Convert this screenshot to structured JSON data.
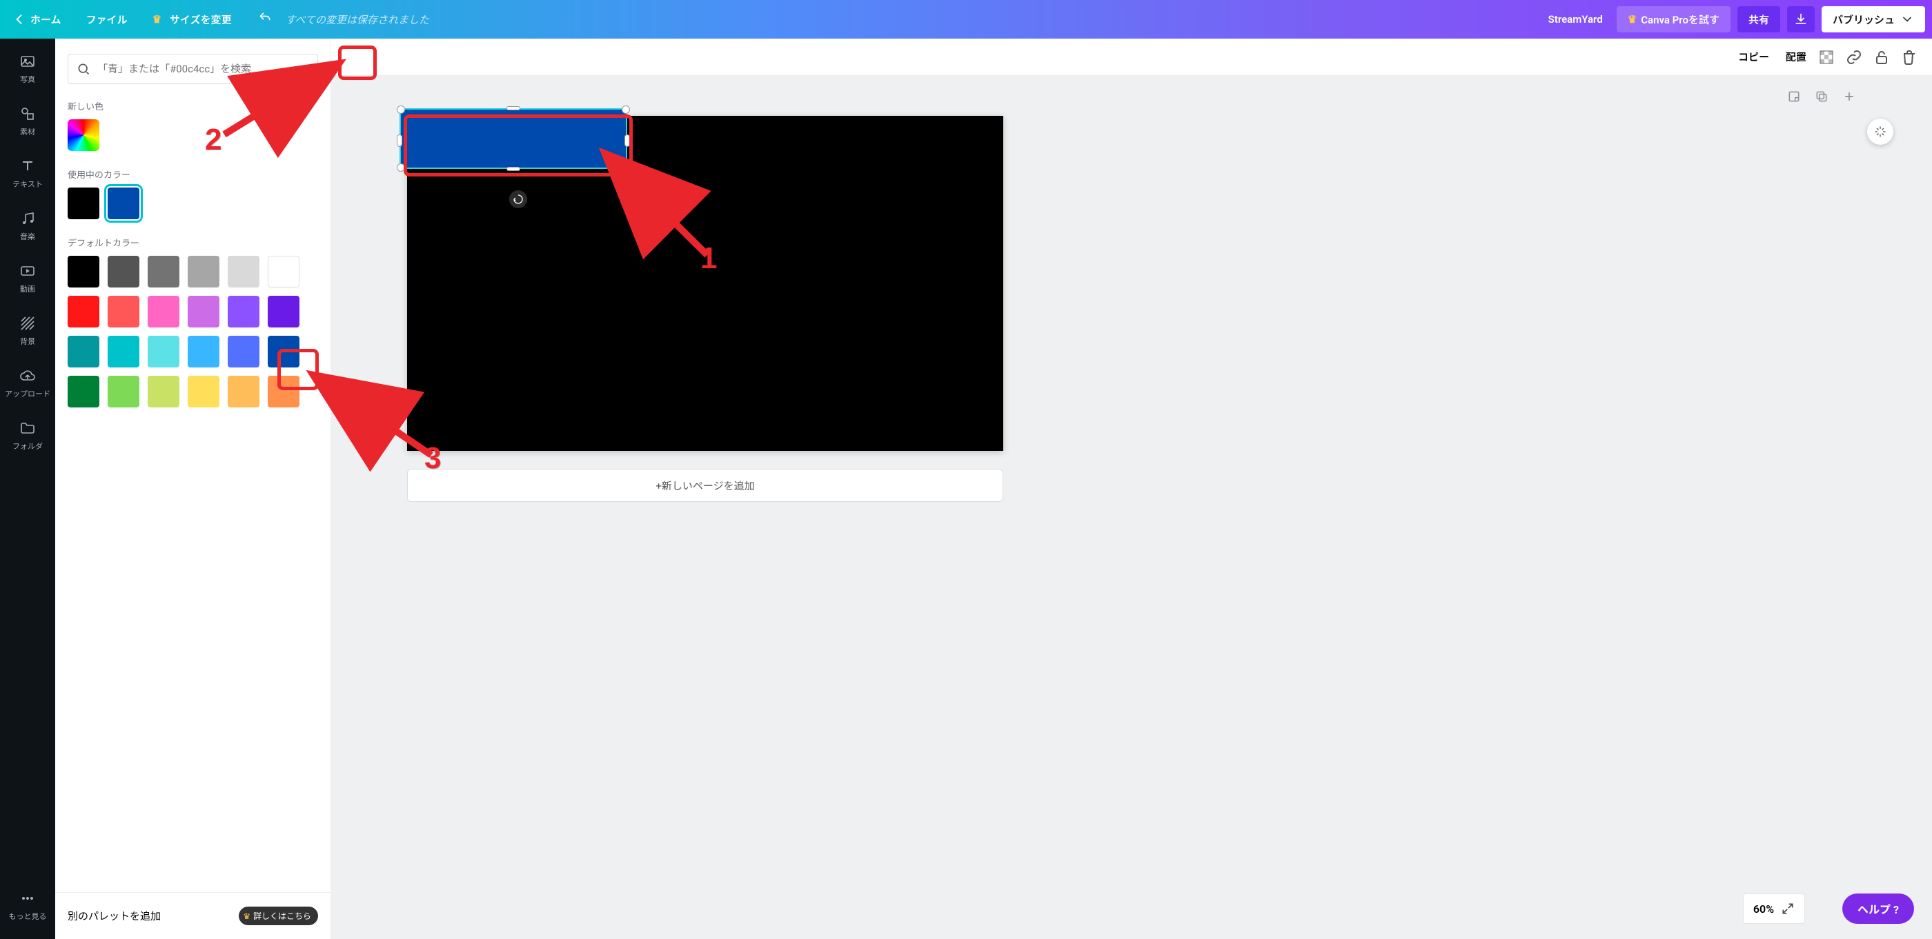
{
  "topbar": {
    "home": "ホーム",
    "file": "ファイル",
    "resize": "サイズを変更",
    "saved": "すべての変更は保存されました",
    "doc_title": "StreamYard",
    "try_pro": "Canva Proを試す",
    "share": "共有",
    "publish": "パブリッシュ"
  },
  "ctxbar": {
    "copy": "コピー",
    "arrange": "配置",
    "chip_color": "#004aad"
  },
  "rail": {
    "photos": "写真",
    "elements": "素材",
    "text": "テキスト",
    "music": "音楽",
    "video": "動画",
    "background": "背景",
    "upload": "アップロード",
    "folder": "フォルダ",
    "more": "もっと見る"
  },
  "panel": {
    "search_placeholder": "「青」または「#00c4cc」を検索",
    "sec_new": "新しい色",
    "sec_inuse": "使用中のカラー",
    "sec_default": "デフォルトカラー",
    "footer_add": "別のパレットを追加",
    "footer_more": "詳しくはこちら",
    "inuse_colors": [
      "#000000",
      "#004aad"
    ],
    "default_colors": [
      "#000000",
      "#545454",
      "#737373",
      "#a6a6a6",
      "#d9d9d9",
      "#ffffff",
      "#ff1616",
      "#ff5757",
      "#ff66c4",
      "#cc6ce7",
      "#8c52ff",
      "#6a1be6",
      "#03989e",
      "#00c2cb",
      "#5ce1e6",
      "#38b6ff",
      "#5271ff",
      "#004aad",
      "#008037",
      "#7ed957",
      "#c9e265",
      "#ffde59",
      "#ffbd59",
      "#ff914d"
    ]
  },
  "canvas": {
    "add_page": "+新しいページを追加",
    "zoom": "60%"
  },
  "help": {
    "label": "ヘルプ ?"
  },
  "annotations": {
    "n1": "1",
    "n2": "2",
    "n3": "3"
  }
}
